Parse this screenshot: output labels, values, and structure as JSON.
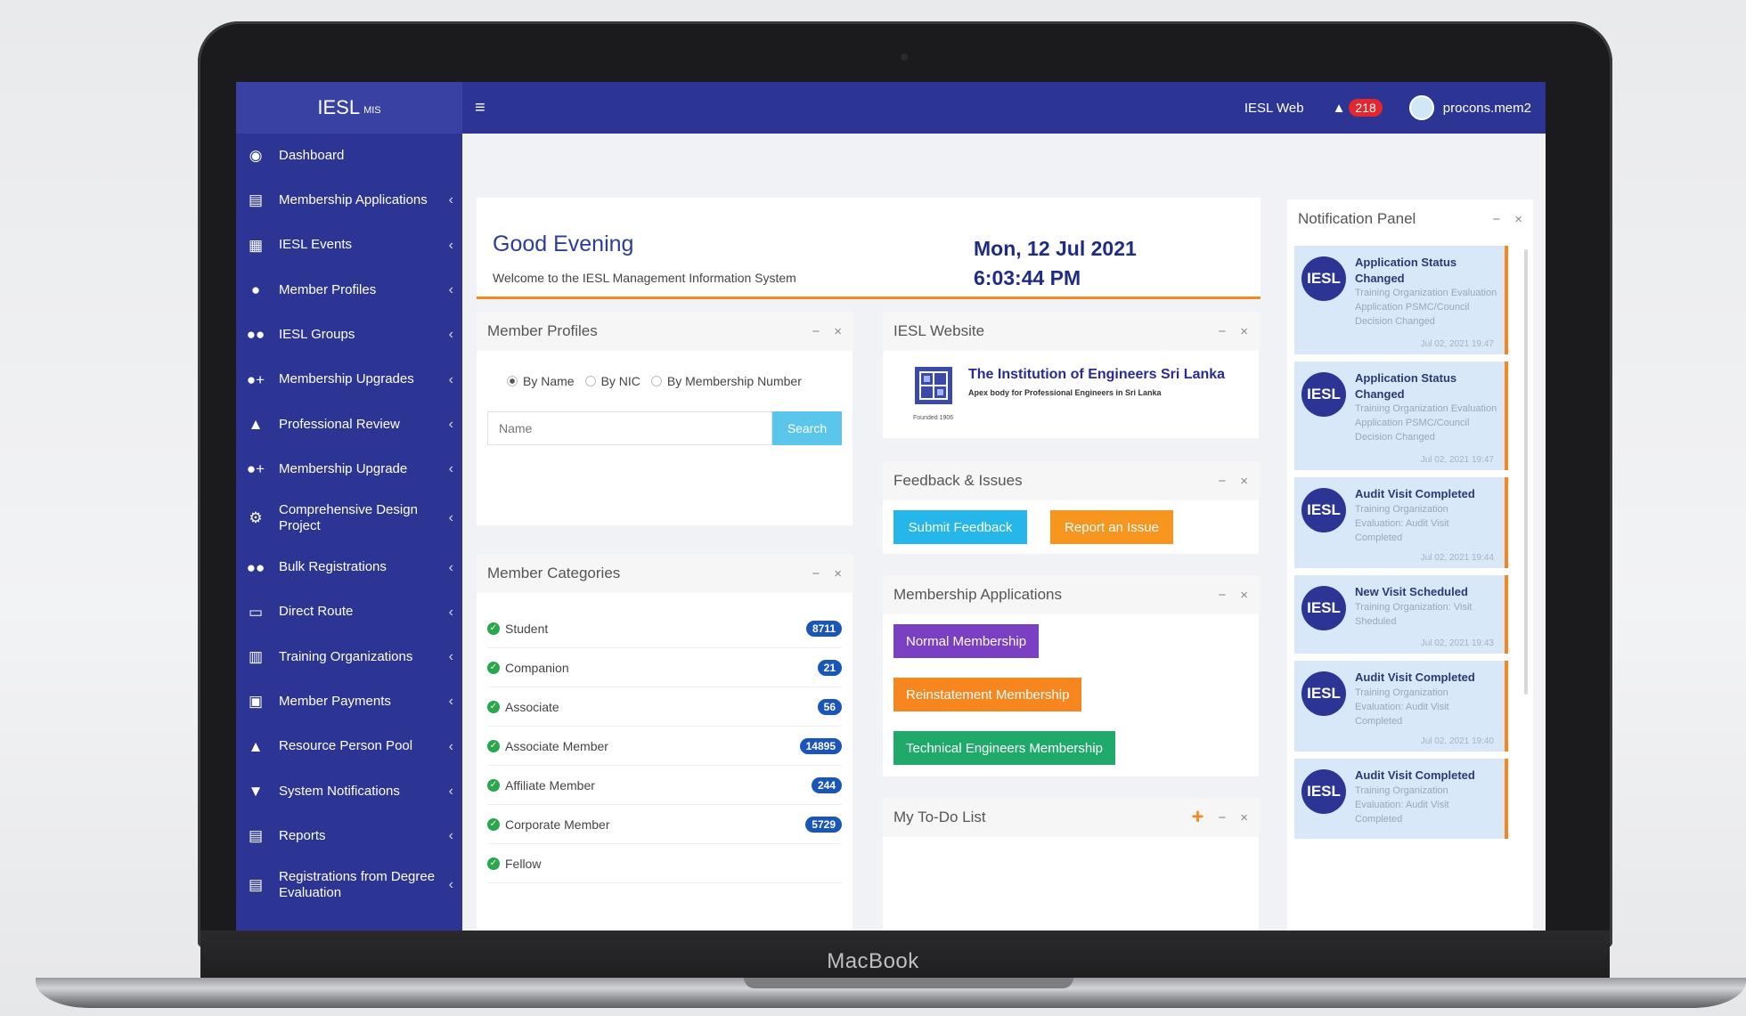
{
  "device": {
    "label": "MacBook"
  },
  "brand": {
    "name": "IESL",
    "suffix": "MIS"
  },
  "sidebar": {
    "items": [
      {
        "label": "Dashboard",
        "icon": "dashboard-icon",
        "glyph": "◉",
        "chevron": ""
      },
      {
        "label": "Membership Applications",
        "icon": "file-icon",
        "glyph": "▤",
        "chevron": "‹"
      },
      {
        "label": "IESL Events",
        "icon": "calendar-icon",
        "glyph": "▦",
        "chevron": "‹"
      },
      {
        "label": "Member Profiles",
        "icon": "user-icon",
        "glyph": "●",
        "chevron": "‹"
      },
      {
        "label": "IESL Groups",
        "icon": "group-icon",
        "glyph": "●●",
        "chevron": "‹"
      },
      {
        "label": "Membership Upgrades",
        "icon": "user-plus-icon",
        "glyph": "●+",
        "chevron": "‹"
      },
      {
        "label": "Professional Review",
        "icon": "thumbs-up-icon",
        "glyph": "▲",
        "chevron": "‹"
      },
      {
        "label": "Membership Upgrade",
        "icon": "user-plus-icon",
        "glyph": "●+",
        "chevron": "‹"
      },
      {
        "label": "Comprehensive Design Project",
        "icon": "cogs-icon",
        "glyph": "⚙",
        "chevron": "‹"
      },
      {
        "label": "Bulk Registrations",
        "icon": "group-icon",
        "glyph": "●●",
        "chevron": "‹"
      },
      {
        "label": "Direct Route",
        "icon": "inbox-icon",
        "glyph": "▭",
        "chevron": "‹"
      },
      {
        "label": "Training Organizations",
        "icon": "building-icon",
        "glyph": "▥",
        "chevron": "‹"
      },
      {
        "label": "Member Payments",
        "icon": "money-icon",
        "glyph": "▣",
        "chevron": "‹"
      },
      {
        "label": "Resource Person Pool",
        "icon": "person-icon",
        "glyph": "▲",
        "chevron": "‹"
      },
      {
        "label": "System Notifications",
        "icon": "bell-icon",
        "glyph": "▼",
        "chevron": "‹"
      },
      {
        "label": "Reports",
        "icon": "file-icon",
        "glyph": "▤",
        "chevron": "‹"
      },
      {
        "label": "Registrations from Degree Evaluation",
        "icon": "file-icon",
        "glyph": "▤",
        "chevron": "‹"
      }
    ]
  },
  "topbar": {
    "menu_glyph": "≡",
    "iesl_web": "IESL Web",
    "bell_glyph": "▲",
    "notification_count": "218",
    "username": "procons.mem2"
  },
  "welcome": {
    "greeting": "Good Evening",
    "subtitle": "Welcome to the IESL Management Information System",
    "date": "Mon, 12 Jul 2021",
    "time": "6:03:44 PM"
  },
  "panel_controls": {
    "minimize": "−",
    "close": "×",
    "add": "+"
  },
  "member_profiles": {
    "title": "Member Profiles",
    "radio_options": [
      "By Name",
      "By NIC",
      "By Membership Number"
    ],
    "selected_option": "By Name",
    "search_placeholder": "Name",
    "search_button": "Search"
  },
  "member_categories": {
    "title": "Member Categories",
    "check_glyph": "✓",
    "items": [
      {
        "label": "Student",
        "count": "8711"
      },
      {
        "label": "Companion",
        "count": "21"
      },
      {
        "label": "Associate",
        "count": "56"
      },
      {
        "label": "Associate Member",
        "count": "14895"
      },
      {
        "label": "Affiliate Member",
        "count": "244"
      },
      {
        "label": "Corporate Member",
        "count": "5729"
      },
      {
        "label": "Fellow",
        "count": ""
      }
    ]
  },
  "iesl_website": {
    "title": "IESL Website",
    "org_name": "The Institution of Engineers Sri Lanka",
    "tagline": "Apex body for Professional Engineers in Sri Lanka",
    "founded": "Founded 1906"
  },
  "feedback": {
    "title": "Feedback & Issues",
    "submit": "Submit Feedback",
    "report": "Report an Issue"
  },
  "membership_applications": {
    "title": "Membership Applications",
    "normal": "Normal Membership",
    "reinstatement": "Reinstatement Membership",
    "technical": "Technical Engineers Membership"
  },
  "todo": {
    "title": "My To-Do List"
  },
  "notifications": {
    "title": "Notification Panel",
    "logo_text": "IESL",
    "items": [
      {
        "title": "Application Status Changed",
        "body": "Training Organization Evaluation Application PSMC/Council Decision Changed",
        "time": "Jul 02, 2021 19:47"
      },
      {
        "title": "Application Status Changed",
        "body": "Training Organization Evaluation Application PSMC/Council Decision Changed",
        "time": "Jul 02, 2021 19:47"
      },
      {
        "title": "Audit Visit Completed",
        "body": "Training Organization Evaluation: Audit Visit Completed",
        "time": "Jul 02, 2021 19:44"
      },
      {
        "title": "New Visit Scheduled",
        "body": "Training Organization: Visit Sheduled",
        "time": "Jul 02, 2021 19:43"
      },
      {
        "title": "Audit Visit Completed",
        "body": "Training Organization Evaluation: Audit Visit Completed",
        "time": "Jul 02, 2021 19:40"
      },
      {
        "title": "Audit Visit Completed",
        "body": "Training Organization Evaluation: Audit Visit Completed",
        "time": ""
      }
    ]
  },
  "colors": {
    "primary": "#2c3593",
    "accent": "#f7861e",
    "info": "#25b7ea",
    "purple": "#7a3fc2",
    "green": "#1faa6b",
    "badge_red": "#e5262c",
    "count_blue": "#1a56b8"
  }
}
